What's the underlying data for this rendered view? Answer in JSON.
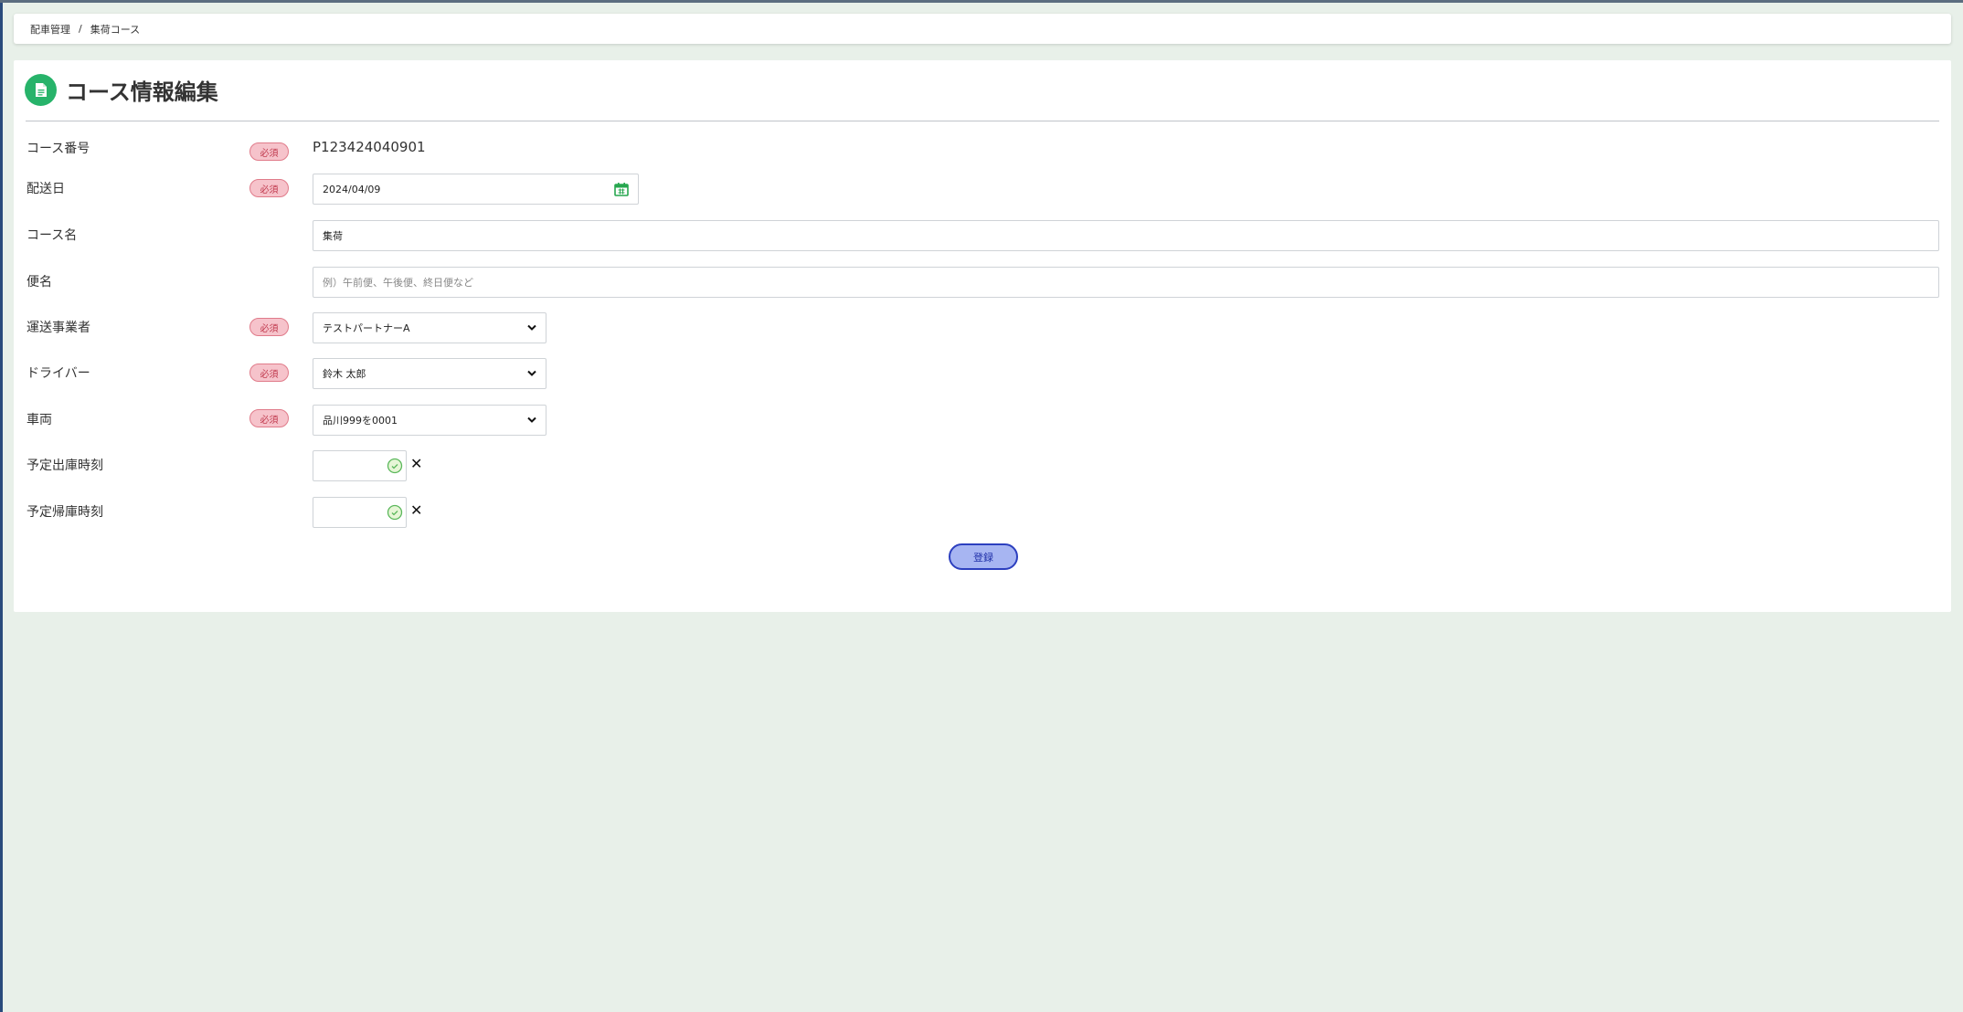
{
  "breadcrumb": {
    "root": "配車管理",
    "separator": "/",
    "current": "集荷コース"
  },
  "page": {
    "title": "コース情報編集"
  },
  "required_label": "必須",
  "form": {
    "course_number": {
      "label": "コース番号",
      "value": "P123424040901"
    },
    "delivery_date": {
      "label": "配送日",
      "value": "2024/04/09"
    },
    "course_name": {
      "label": "コース名",
      "value": "集荷"
    },
    "service_name": {
      "label": "便名",
      "placeholder": "例）午前便、午後便、終日便など"
    },
    "carrier": {
      "label": "運送事業者",
      "value": "テストパートナーA"
    },
    "driver": {
      "label": "ドライバー",
      "value": "鈴木 太郎"
    },
    "vehicle": {
      "label": "車両",
      "value": "品川999を0001"
    },
    "departure_time": {
      "label": "予定出庫時刻",
      "value": ""
    },
    "return_time": {
      "label": "予定帰庫時刻",
      "value": ""
    }
  },
  "submit_label": "登録",
  "colors": {
    "accent_green": "#27b36a",
    "required_bg": "#f6c3cb",
    "button_bg": "#a7b5f2",
    "button_border": "#2c3fbf",
    "page_bg": "#e8f0e9"
  },
  "icons": {
    "title": "document-icon",
    "date": "calendar-icon",
    "select": "chevron-down-icon",
    "time": "clock-icon",
    "clear": "close-icon"
  }
}
